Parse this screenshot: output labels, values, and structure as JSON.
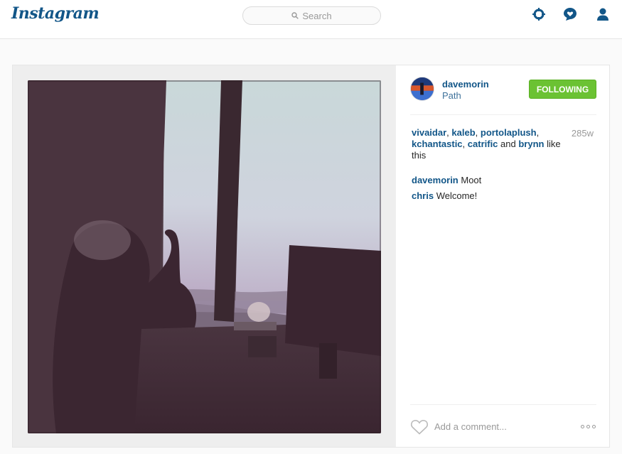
{
  "header": {
    "logo": "Instagram",
    "search_placeholder": "Search",
    "icons": [
      "explore-icon",
      "activity-icon",
      "profile-icon"
    ]
  },
  "post": {
    "owner": {
      "username": "davemorin",
      "location": "Path"
    },
    "follow_label": "FOLLOWING",
    "likers": [
      "vivaidar",
      "kaleb",
      "portolaplush",
      "kchantastic",
      "catrific",
      "brynn"
    ],
    "likes_suffix": "like this",
    "age": "285w",
    "comments": [
      {
        "user": "davemorin",
        "text": "Moot"
      },
      {
        "user": "chris",
        "text": "Welcome!"
      }
    ],
    "comment_placeholder": "Add a comment..."
  },
  "colors": {
    "brand": "#125688",
    "follow_green": "#6bc233",
    "link_blue": "#125688"
  }
}
